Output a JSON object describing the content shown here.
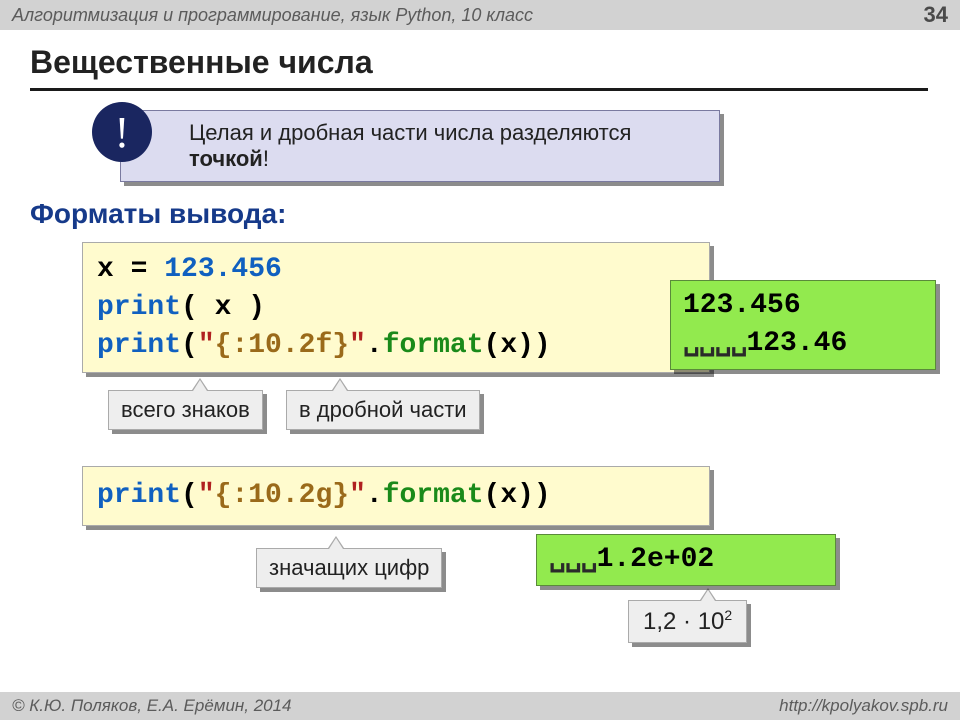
{
  "header": {
    "subject": "Алгоритмизация и программирование, язык Python, 10 класс",
    "page_number": "34"
  },
  "title": "Вещественные числа",
  "callout": {
    "bang": "!",
    "text_before": "Целая и дробная части числа разделяются ",
    "text_bold": "точкой",
    "text_after": "!"
  },
  "subhead": "Форматы вывода:",
  "code1": {
    "l1_a": "x = ",
    "l1_b": "123.456",
    "l2_a": "print",
    "l2_b": "( x )",
    "l3_a": "print",
    "l3_b": "(",
    "l3_c": "\"",
    "l3_d": "{:10.2f}",
    "l3_e": "\"",
    "l3_f": ".",
    "l3_g": "format",
    "l3_h": "(x))"
  },
  "out1": {
    "l1": "123.456",
    "l2_spaces": "␣␣␣␣",
    "l2_val": "123.46"
  },
  "tags": {
    "total": "всего знаков",
    "frac": "в дробной части",
    "sig": "значащих цифр"
  },
  "code2": {
    "a": "print",
    "b": "(",
    "c": "\"",
    "d": "{:10.2g}",
    "e": "\"",
    "f": ".",
    "g": "format",
    "h": "(x))"
  },
  "out2": {
    "spaces": "␣␣␣",
    "val": "1.2e+02"
  },
  "math": {
    "mantissa": "1,2",
    "dot": " · ",
    "base": "10",
    "exp": "2"
  },
  "footer": {
    "left": "© К.Ю. Поляков, Е.А. Ерёмин, 2014",
    "right": "http://kpolyakov.spb.ru"
  }
}
